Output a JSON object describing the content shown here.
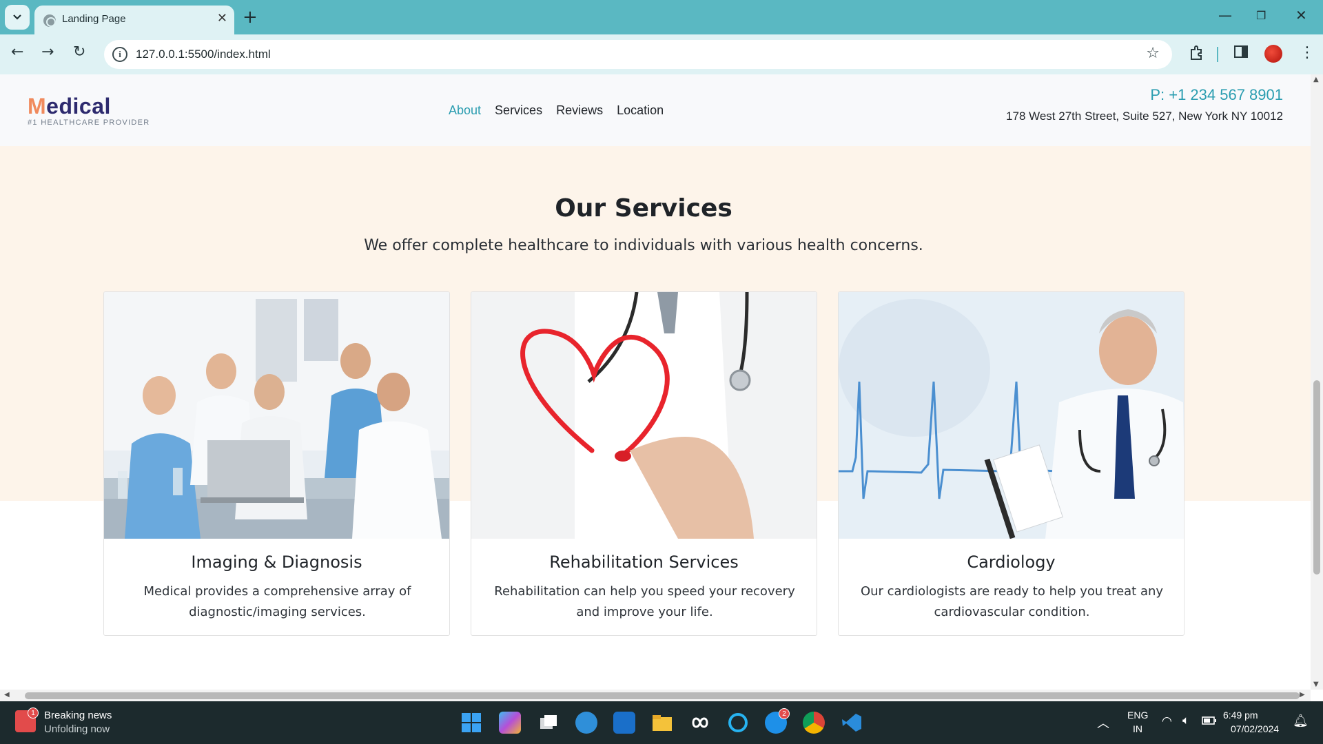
{
  "browser": {
    "tab_title": "Landing Page",
    "url": "127.0.0.1:5500/index.html",
    "new_tab_symbol": "+",
    "close_symbol": "✕"
  },
  "site": {
    "logo_first": "M",
    "logo_rest": "edical",
    "tagline": "#1 HEALTHCARE PROVIDER",
    "nav": [
      {
        "label": "About",
        "active": true
      },
      {
        "label": "Services",
        "active": false
      },
      {
        "label": "Reviews",
        "active": false
      },
      {
        "label": "Location",
        "active": false
      }
    ],
    "phone": "P: +1 234 567 8901",
    "address": "178 West 27th Street, Suite 527, New York NY 10012"
  },
  "services": {
    "title": "Our Services",
    "subtitle": "We offer complete healthcare to individuals with various health concerns.",
    "cards": [
      {
        "title": "Imaging & Diagnosis",
        "description": "Medical provides a comprehensive array of diagnostic/imaging services.",
        "image": "doctors-team-meeting-photo"
      },
      {
        "title": "Rehabilitation Services",
        "description": "Rehabilitation can help you speed your recovery and improve your life.",
        "image": "doctor-drawing-heart-photo"
      },
      {
        "title": "Cardiology",
        "description": "Our cardiologists are ready to help you treat any cardiovascular condition.",
        "image": "cardiologist-ecg-photo"
      }
    ]
  },
  "taskbar": {
    "news_title": "Breaking news",
    "news_sub": "Unfolding now",
    "news_badge": "1",
    "skype_badge": "2",
    "lang_1": "ENG",
    "lang_2": "IN",
    "time": "6:49 pm",
    "date": "07/02/2024"
  },
  "colors": {
    "accent": "#2a9db0",
    "logo_navy": "#2d2a6e",
    "logo_orange": "#f08a5d",
    "section_bg": "#fdf4ea",
    "chrome_teal": "#5ab8c2"
  }
}
